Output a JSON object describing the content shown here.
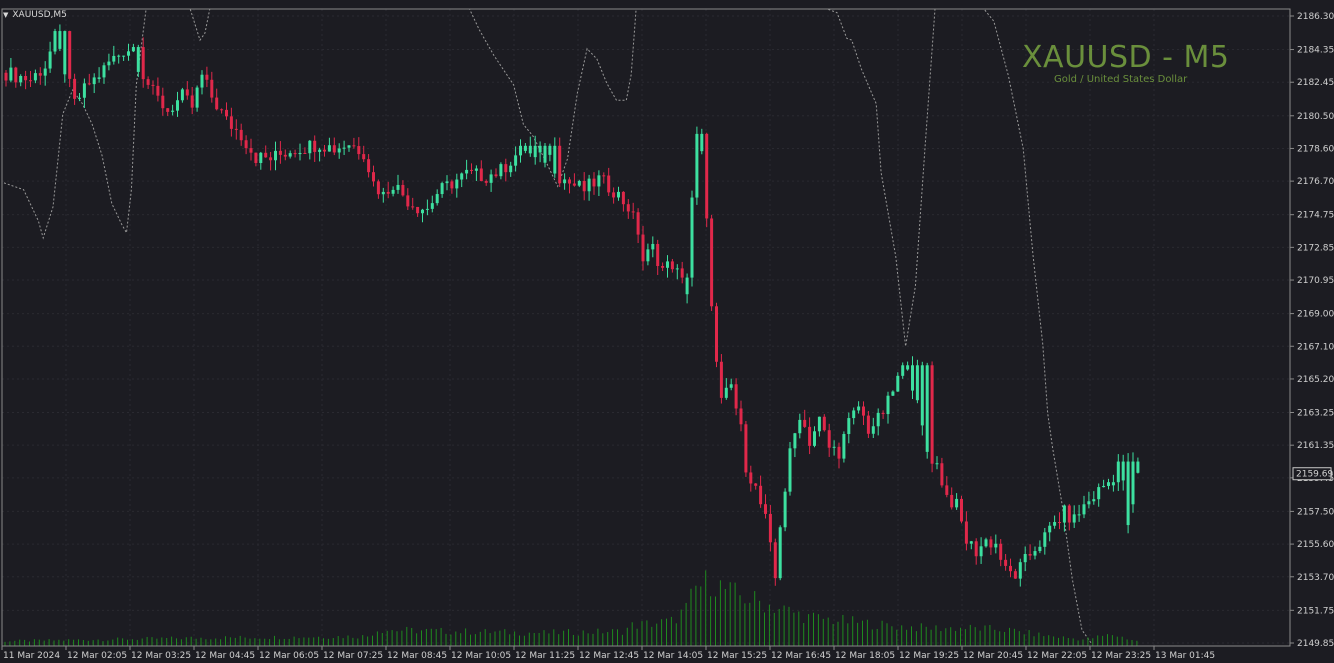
{
  "window": {
    "symbol_label": "XAUUSD,M5",
    "watermark_symbol": "XAUUSD - M5",
    "watermark_desc": "Gold / United States Dollar"
  },
  "colors": {
    "background": "#1c1c22",
    "bull": "#3de0a0",
    "bear": "#e0284a",
    "volume": "#1f8a1f",
    "watermark": "#6a8f3c",
    "indicator": "#9a9a9a"
  },
  "chart_data": {
    "type": "candlestick",
    "ylim": [
      2149.85,
      2186.3
    ],
    "price_ticks": [
      "2186.30",
      "2184.35",
      "2182.45",
      "2180.50",
      "2178.60",
      "2176.70",
      "2174.75",
      "2172.85",
      "2170.95",
      "2169.00",
      "2167.10",
      "2165.20",
      "2163.25",
      "2161.35",
      "2159.45",
      "2157.50",
      "2155.60",
      "2153.70",
      "2151.75",
      "2149.85"
    ],
    "current_price": "2159.69",
    "time_labels": [
      "11 Mar 2024",
      "12 Mar 02:05",
      "12 Mar 03:25",
      "12 Mar 04:45",
      "12 Mar 06:05",
      "12 Mar 07:25",
      "12 Mar 08:45",
      "12 Mar 10:05",
      "12 Mar 11:25",
      "12 Mar 12:45",
      "12 Mar 14:05",
      "12 Mar 15:25",
      "12 Mar 16:45",
      "12 Mar 18:05",
      "12 Mar 19:25",
      "12 Mar 20:45",
      "12 Mar 22:05",
      "12 Mar 23:25",
      "13 Mar 01:45"
    ],
    "close_path": [
      [
        0,
        2183.0
      ],
      [
        5,
        2182.6
      ],
      [
        8,
        2183.4
      ],
      [
        10,
        2185.0
      ],
      [
        12,
        2183.2
      ],
      [
        14,
        2181.2
      ],
      [
        17,
        2182.4
      ],
      [
        19,
        2182.8
      ],
      [
        21,
        2183.6
      ],
      [
        24,
        2184.3
      ],
      [
        26,
        2184.5
      ],
      [
        27,
        2183.5
      ],
      [
        30,
        2181.8
      ],
      [
        33,
        2180.8
      ],
      [
        36,
        2181.6
      ],
      [
        38,
        2181.0
      ],
      [
        40,
        2182.8
      ],
      [
        42,
        2181.6
      ],
      [
        45,
        2180.2
      ],
      [
        48,
        2179.4
      ],
      [
        51,
        2178.1
      ],
      [
        54,
        2178.0
      ],
      [
        58,
        2178.5
      ],
      [
        61,
        2178.7
      ],
      [
        64,
        2178.9
      ],
      [
        67,
        2178.6
      ],
      [
        70,
        2178.9
      ],
      [
        73,
        2178.4
      ],
      [
        75,
        2176.6
      ],
      [
        77,
        2175.9
      ],
      [
        79,
        2176.6
      ],
      [
        82,
        2175.6
      ],
      [
        84,
        2175.2
      ],
      [
        86,
        2175.1
      ],
      [
        88,
        2176.0
      ],
      [
        91,
        2176.6
      ],
      [
        94,
        2177.1
      ],
      [
        98,
        2177.0
      ],
      [
        101,
        2177.3
      ],
      [
        104,
        2178.2
      ],
      [
        106,
        2178.6
      ],
      [
        108,
        2177.9
      ],
      [
        111,
        2178.1
      ],
      [
        113,
        2177.0
      ],
      [
        115,
        2176.6
      ],
      [
        118,
        2176.2
      ],
      [
        121,
        2176.8
      ],
      [
        124,
        2176.2
      ],
      [
        127,
        2175.2
      ],
      [
        129,
        2173.8
      ],
      [
        130,
        2172.1
      ],
      [
        132,
        2172.8
      ],
      [
        134,
        2171.6
      ],
      [
        136,
        2171.9
      ],
      [
        138,
        2170.8
      ],
      [
        139,
        2170.4
      ],
      [
        140,
        2175.8
      ],
      [
        141,
        2179.2
      ],
      [
        142,
        2178.2
      ],
      [
        143,
        2174.2
      ],
      [
        144,
        2169.8
      ],
      [
        145,
        2166.0
      ],
      [
        146,
        2163.8
      ],
      [
        148,
        2164.8
      ],
      [
        150,
        2162.2
      ],
      [
        151,
        2160.2
      ],
      [
        153,
        2158.8
      ],
      [
        155,
        2157.0
      ],
      [
        157,
        2153.6
      ],
      [
        158,
        2156.8
      ],
      [
        160,
        2160.8
      ],
      [
        162,
        2163.2
      ],
      [
        164,
        2161.6
      ],
      [
        166,
        2162.8
      ],
      [
        168,
        2161.2
      ],
      [
        170,
        2161.0
      ],
      [
        172,
        2162.6
      ],
      [
        174,
        2163.6
      ],
      [
        176,
        2162.3
      ],
      [
        178,
        2162.8
      ],
      [
        180,
        2163.8
      ],
      [
        182,
        2165.2
      ],
      [
        184,
        2166.2
      ],
      [
        186,
        2163.6
      ],
      [
        188,
        2161.0
      ],
      [
        190,
        2160.2
      ],
      [
        192,
        2158.4
      ],
      [
        194,
        2157.8
      ],
      [
        196,
        2155.8
      ],
      [
        198,
        2155.2
      ],
      [
        200,
        2155.8
      ],
      [
        202,
        2155.6
      ],
      [
        204,
        2154.0
      ],
      [
        206,
        2153.8
      ],
      [
        208,
        2154.6
      ],
      [
        210,
        2155.4
      ],
      [
        212,
        2156.0
      ],
      [
        214,
        2156.8
      ],
      [
        216,
        2157.4
      ],
      [
        218,
        2157.0
      ],
      [
        220,
        2157.8
      ],
      [
        222,
        2158.4
      ],
      [
        224,
        2159.0
      ],
      [
        226,
        2159.4
      ],
      [
        227,
        2160.4
      ],
      [
        228,
        2159.0
      ],
      [
        229,
        2156.8
      ],
      [
        230,
        2157.6
      ],
      [
        231,
        2159.69
      ]
    ],
    "indicator_path": [
      [
        0,
        2176.6
      ],
      [
        4,
        2176.2
      ],
      [
        7,
        2174.4
      ],
      [
        8,
        2173.4
      ],
      [
        10,
        2175.2
      ],
      [
        12,
        2180.6
      ],
      [
        14,
        2182.0
      ],
      [
        16,
        2181.2
      ],
      [
        18,
        2180.0
      ],
      [
        20,
        2178.2
      ],
      [
        22,
        2175.4
      ],
      [
        24,
        2174.2
      ],
      [
        25,
        2173.7
      ],
      [
        26,
        2176.2
      ],
      [
        27,
        2182.3
      ],
      [
        29,
        2186.9
      ],
      [
        31,
        2187.9
      ],
      [
        38,
        2187.9
      ],
      [
        40,
        2184.9
      ],
      [
        41,
        2185.3
      ],
      [
        42,
        2187.9
      ],
      [
        75,
        2187.9
      ],
      [
        95,
        2187.9
      ],
      [
        97,
        2185.5
      ],
      [
        100,
        2184.0
      ],
      [
        104,
        2182.3
      ],
      [
        106,
        2180.0
      ],
      [
        108,
        2179.3
      ],
      [
        111,
        2177.6
      ],
      [
        113,
        2176.4
      ],
      [
        115,
        2178.0
      ],
      [
        117,
        2181.8
      ],
      [
        119,
        2184.4
      ],
      [
        121,
        2183.8
      ],
      [
        123,
        2182.4
      ],
      [
        125,
        2181.4
      ],
      [
        127,
        2181.4
      ],
      [
        128,
        2182.9
      ],
      [
        129,
        2187.9
      ],
      [
        138,
        2187.9
      ],
      [
        140,
        2187.9
      ],
      [
        142,
        2187.9
      ],
      [
        150,
        2187.9
      ],
      [
        168,
        2187.9
      ],
      [
        170,
        2186.5
      ],
      [
        172,
        2185.0
      ],
      [
        173,
        2184.9
      ],
      [
        175,
        2183.2
      ],
      [
        178,
        2181.2
      ],
      [
        179,
        2177.2
      ],
      [
        182,
        2172.3
      ],
      [
        184,
        2167.1
      ],
      [
        186,
        2170.6
      ],
      [
        188,
        2178.8
      ],
      [
        190,
        2187.9
      ],
      [
        200,
        2187.9
      ],
      [
        202,
        2186.0
      ],
      [
        205,
        2182.8
      ],
      [
        208,
        2178.6
      ],
      [
        210,
        2172.4
      ],
      [
        212,
        2167.2
      ],
      [
        213,
        2163.2
      ],
      [
        214,
        2161.2
      ],
      [
        216,
        2157.8
      ],
      [
        218,
        2153.6
      ],
      [
        220,
        2150.6
      ],
      [
        222,
        2149.8
      ]
    ],
    "volume_profile": [
      [
        0,
        0.06
      ],
      [
        20,
        0.08
      ],
      [
        40,
        0.1
      ],
      [
        60,
        0.11
      ],
      [
        74,
        0.12
      ],
      [
        76,
        0.2
      ],
      [
        90,
        0.18
      ],
      [
        110,
        0.16
      ],
      [
        126,
        0.18
      ],
      [
        128,
        0.25
      ],
      [
        136,
        0.3
      ],
      [
        139,
        0.45
      ],
      [
        141,
        0.7
      ],
      [
        144,
        0.8
      ],
      [
        148,
        0.65
      ],
      [
        156,
        0.5
      ],
      [
        164,
        0.35
      ],
      [
        172,
        0.3
      ],
      [
        180,
        0.25
      ],
      [
        188,
        0.22
      ],
      [
        196,
        0.22
      ],
      [
        204,
        0.2
      ],
      [
        212,
        0.13
      ],
      [
        220,
        0.08
      ],
      [
        226,
        0.14
      ],
      [
        231,
        0.06
      ]
    ]
  }
}
